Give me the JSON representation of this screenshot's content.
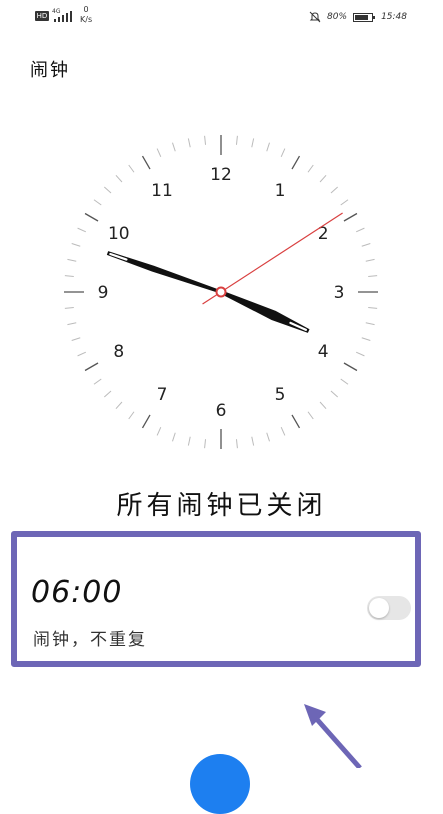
{
  "status_bar": {
    "hd_label": "HD",
    "network_label": "4G",
    "speed_value": "0",
    "speed_unit": "K/s",
    "battery": "80%",
    "time": "15:48"
  },
  "header": {
    "title": "闹钟"
  },
  "clock": {
    "numbers": [
      "12",
      "1",
      "2",
      "3",
      "4",
      "5",
      "6",
      "7",
      "8",
      "9",
      "10",
      "11"
    ],
    "hour": 3,
    "minute": 48,
    "second": 9.5,
    "second_hand_color": "#d94040"
  },
  "status_heading": "所有闹钟已关闭",
  "alarm": {
    "time": "06:00",
    "description": "闹钟，不重复",
    "enabled": false
  },
  "colors": {
    "highlight_border": "#6d66b6",
    "fab": "#1d7ff0"
  }
}
